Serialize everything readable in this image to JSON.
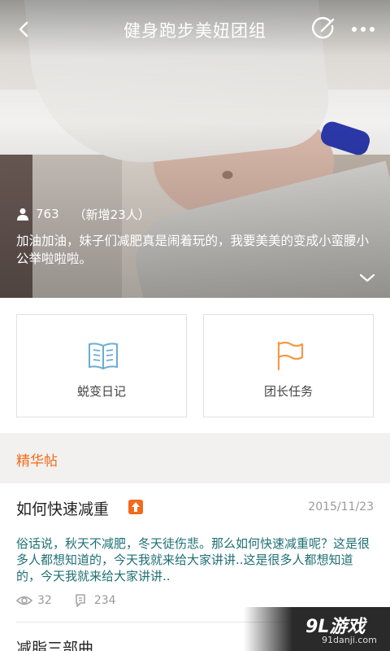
{
  "header": {
    "title": "健身跑步美妞团组",
    "back_icon": "chevron-left-icon",
    "edit_icon": "edit-circle-icon",
    "more_icon": "more-dots-icon"
  },
  "group": {
    "member_count": "763",
    "new_members": "（新增23人）",
    "description": "加油加油，妹子们减肥真是闹着玩的，我要美美的变成小蛮腰小公举啦啦啦。"
  },
  "cards": [
    {
      "label": "蜕变日记",
      "icon": "open-book-icon"
    },
    {
      "label": "团长任务",
      "icon": "flag-icon"
    }
  ],
  "section": {
    "label": "精华帖"
  },
  "post": {
    "title": "如何快速减重",
    "date": "2015/11/23",
    "body": "俗话说，秋天不减肥，冬天徒伤悲。那么如何快速减重呢？这是很多人都想知道的，今天我就来给大家讲讲..这是很多人都想知道的，今天我就来给大家讲讲..",
    "views": "32",
    "replies": "234"
  },
  "post2": {
    "title": "减脂三部曲"
  },
  "watermark": {
    "brand": "9L游戏",
    "domain": "91danji.com"
  },
  "colors": {
    "accent": "#f26a1b",
    "card_icon_blue": "#6aaed0",
    "card_icon_orange": "#f29a4a",
    "body_text": "#1f6f73"
  }
}
